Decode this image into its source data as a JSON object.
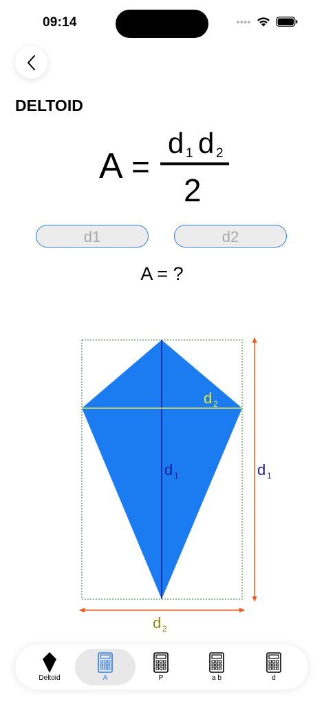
{
  "status": {
    "time": "09:14"
  },
  "page": {
    "title": "DELTOID"
  },
  "formula": {
    "lhs": "A",
    "equals": "=",
    "numerator_d": "d",
    "sub1": "1",
    "sub2": "2",
    "denominator": "2"
  },
  "inputs": [
    {
      "placeholder": "d1"
    },
    {
      "placeholder": "d2"
    }
  ],
  "result": {
    "text": "A = ?"
  },
  "figure": {
    "d1_label": "d",
    "d1_sub": "1",
    "d2_label": "d",
    "d2_sub": "2",
    "colors": {
      "kite": "#1a7cf0",
      "diagonal_d1": "#1a1a9a",
      "diagonal_d2": "#e8e832",
      "dimension": "#f05a1e",
      "guide": "#2a8a2a",
      "d2_dim_label": "#8a8a10"
    }
  },
  "tabs": [
    {
      "label": "Deltoid",
      "icon": "deltoid-shape-icon",
      "active": false
    },
    {
      "label": "A",
      "icon": "calculator-icon",
      "active": true
    },
    {
      "label": "P",
      "icon": "calculator-icon",
      "active": false
    },
    {
      "label": "a b",
      "icon": "calculator-icon",
      "active": false
    },
    {
      "label": "d",
      "icon": "calculator-icon",
      "active": false
    }
  ]
}
